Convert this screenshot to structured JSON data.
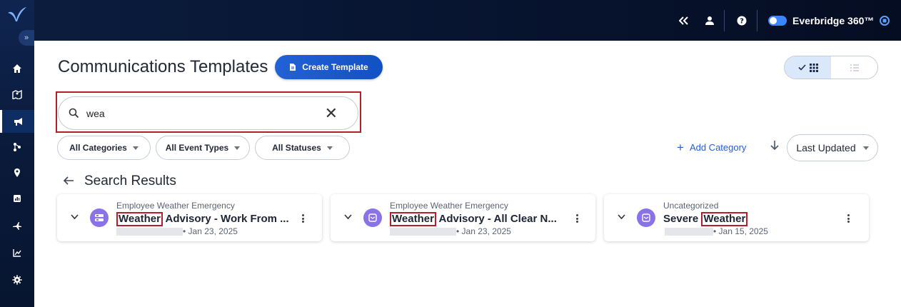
{
  "header": {
    "collapse_icon": "double-chevron-left-icon",
    "user_icon": "user-icon",
    "help_icon": "help-icon",
    "brand_name": "Everbridge 360™",
    "brand_toggle_on": true,
    "brand_chevron_icon": "chevron-down-icon"
  },
  "sidebar": {
    "expand_label": "»",
    "items": [
      {
        "name": "home",
        "icon": "home-icon",
        "active": false
      },
      {
        "name": "map",
        "icon": "map-icon",
        "active": false
      },
      {
        "name": "communications",
        "icon": "megaphone-icon",
        "active": true
      },
      {
        "name": "orchestration",
        "icon": "people-network-icon",
        "active": false
      },
      {
        "name": "locations",
        "icon": "location-pin-icon",
        "active": false
      },
      {
        "name": "reports",
        "icon": "report-icon",
        "active": false
      },
      {
        "name": "integrations",
        "icon": "plane-icon",
        "active": false
      },
      {
        "name": "analytics",
        "icon": "chart-line-icon",
        "active": false
      },
      {
        "name": "settings",
        "icon": "gear-icon",
        "active": false
      }
    ]
  },
  "page": {
    "title": "Communications Templates",
    "create_button_label": "Create Template"
  },
  "view_toggle": {
    "grid_selected": true
  },
  "search": {
    "value": "wea",
    "placeholder": ""
  },
  "filters": [
    {
      "label": "All Categories"
    },
    {
      "label": "All Event Types"
    },
    {
      "label": "All Statuses"
    }
  ],
  "add_category_label": "Add Category",
  "sort": {
    "direction": "descending",
    "selected": "Last Updated"
  },
  "results": {
    "heading": "Search Results",
    "cards": [
      {
        "category": "Employee Weather Emergency",
        "title_match": "Weather",
        "title_rest": " Advisory - Work From ...",
        "title_pre": "",
        "date": "• Jan 23, 2025"
      },
      {
        "category": "Employee Weather Emergency",
        "title_match": "Weather",
        "title_rest": " Advisory - All Clear N...",
        "title_pre": "",
        "date": "• Jan 23, 2025"
      },
      {
        "category": "Uncategorized",
        "title_pre": "Severe ",
        "title_match": "Weather",
        "title_rest": "",
        "date": "• Jan 15, 2025"
      }
    ]
  },
  "colors": {
    "accent": "#1f5fd0",
    "highlight_border": "#b3202c",
    "avatar": "#8a73e8",
    "topbar": "#081633"
  }
}
